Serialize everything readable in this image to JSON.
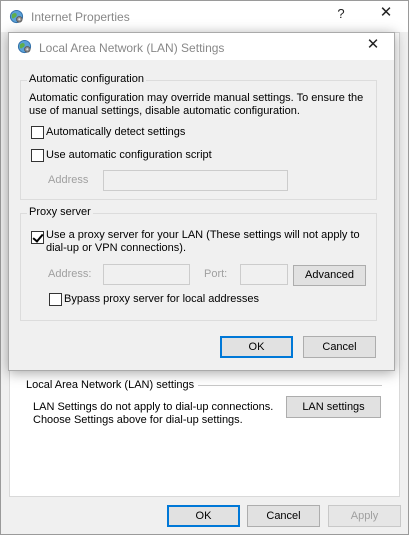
{
  "parent": {
    "title": "Internet Properties",
    "help_label": "?",
    "close_label": "✕",
    "lan_section": {
      "title": "Local Area Network (LAN) settings",
      "note_line1": "LAN Settings do not apply to dial-up connections.",
      "note_line2": "Choose Settings above for dial-up settings.",
      "lan_settings_button": "LAN settings"
    },
    "buttons": {
      "ok": "OK",
      "cancel": "Cancel",
      "apply": "Apply"
    }
  },
  "dialog": {
    "title": "Local Area Network (LAN) Settings",
    "close_label": "✕",
    "auto_config": {
      "group_label": "Automatic configuration",
      "description_line1": "Automatic configuration may override manual settings.  To ensure the",
      "description_line2": "use of manual settings, disable automatic configuration.",
      "auto_detect_label": "Automatically detect settings",
      "auto_detect_checked": false,
      "use_script_label": "Use automatic configuration script",
      "use_script_checked": false,
      "address_label": "Address",
      "address_value": ""
    },
    "proxy": {
      "group_label": "Proxy server",
      "use_proxy_line1": "Use a proxy server for your LAN (These settings will not apply to",
      "use_proxy_line2": "dial-up or VPN connections).",
      "use_proxy_checked": true,
      "address_label": "Address:",
      "address_value": "",
      "port_label": "Port:",
      "port_value": "",
      "advanced_button": "Advanced",
      "bypass_label": "Bypass proxy server for local addresses",
      "bypass_checked": false
    },
    "buttons": {
      "ok": "OK",
      "cancel": "Cancel"
    }
  },
  "colors": {
    "window_bg": "#f0f0f0",
    "titlebar_bg": "#ffffff",
    "button_bg": "#e1e1e1",
    "default_button_border": "#0078d7",
    "disabled_text": "#a0a0a0"
  },
  "icons": {
    "app_icon": "internet-globe-icon",
    "close": "close-icon",
    "help": "help-icon",
    "checkmark": "checkmark-icon"
  }
}
